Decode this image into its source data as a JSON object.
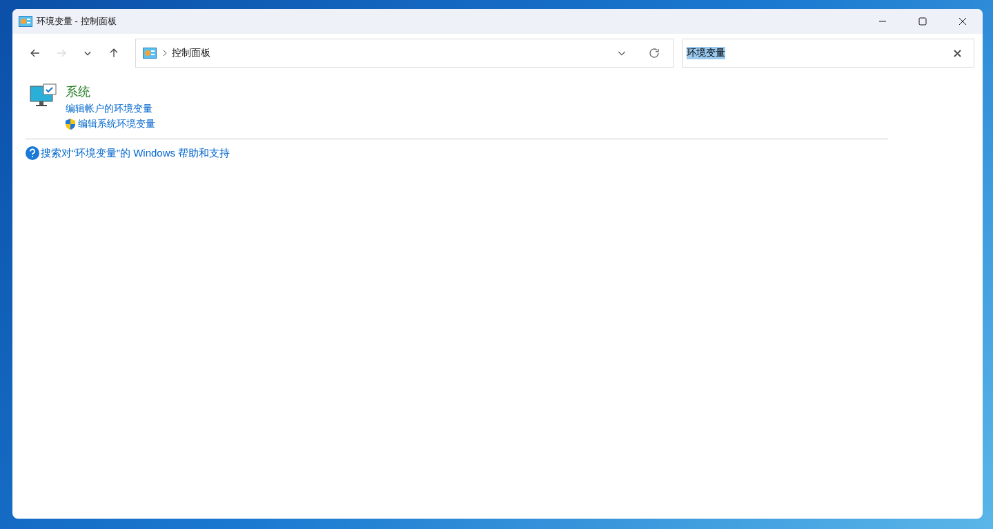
{
  "window": {
    "title": "环境变量 - 控制面板"
  },
  "nav_buttons": [
    {
      "kind": "back",
      "disabled": false
    },
    {
      "kind": "forward",
      "disabled": true
    },
    {
      "kind": "recent",
      "disabled": false
    },
    {
      "kind": "up",
      "disabled": false
    }
  ],
  "address_bar": {
    "path": [
      "控制面板"
    ]
  },
  "search": {
    "value": "环境变量",
    "selected": true
  },
  "results": [
    {
      "title": "系统",
      "links": [
        {
          "label": "编辑帐户的环境变量",
          "shield": false
        },
        {
          "label": "编辑系统环境变量",
          "shield": true
        }
      ]
    }
  ],
  "help_link": "搜索对“环境变量”的 Windows 帮助和支持"
}
